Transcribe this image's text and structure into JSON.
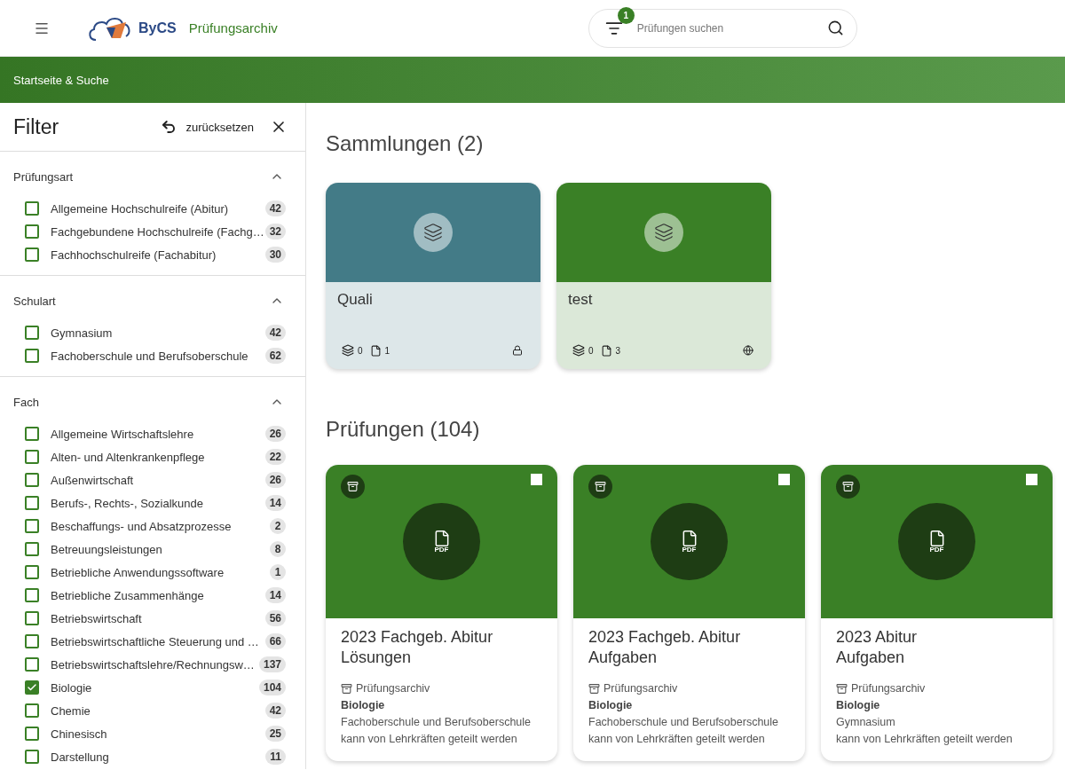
{
  "header": {
    "brand": "ByCS",
    "app_name": "Prüfungsarchiv",
    "search": {
      "placeholder": "Prüfungen suchen",
      "filter_count": "1"
    }
  },
  "breadcrumb": "Startseite & Suche",
  "filter": {
    "title": "Filter",
    "reset_label": "zurücksetzen",
    "sections": [
      {
        "title": "Prüfungsart",
        "expanded": true,
        "items": [
          {
            "label": "Allgemeine Hochschulreife (Abitur)",
            "count": "42",
            "checked": false
          },
          {
            "label": "Fachgebundene Hochschulreife (Fachg…",
            "count": "32",
            "checked": false
          },
          {
            "label": "Fachhochschulreife (Fachabitur)",
            "count": "30",
            "checked": false
          }
        ]
      },
      {
        "title": "Schulart",
        "expanded": true,
        "items": [
          {
            "label": "Gymnasium",
            "count": "42",
            "checked": false
          },
          {
            "label": "Fachoberschule und Berufsoberschule",
            "count": "62",
            "checked": false
          }
        ]
      },
      {
        "title": "Fach",
        "expanded": true,
        "items": [
          {
            "label": "Allgemeine Wirtschaftslehre",
            "count": "26",
            "checked": false
          },
          {
            "label": "Alten- und Altenkrankenpflege",
            "count": "22",
            "checked": false
          },
          {
            "label": "Außenwirtschaft",
            "count": "26",
            "checked": false
          },
          {
            "label": "Berufs-, Rechts-, Sozialkunde",
            "count": "14",
            "checked": false
          },
          {
            "label": "Beschaffungs- und Absatzprozesse",
            "count": "2",
            "checked": false
          },
          {
            "label": "Betreuungsleistungen",
            "count": "8",
            "checked": false
          },
          {
            "label": "Betriebliche Anwendungssoftware",
            "count": "1",
            "checked": false
          },
          {
            "label": "Betriebliche Zusammenhänge",
            "count": "14",
            "checked": false
          },
          {
            "label": "Betriebswirtschaft",
            "count": "56",
            "checked": false
          },
          {
            "label": "Betriebswirtschaftliche Steuerung und …",
            "count": "66",
            "checked": false
          },
          {
            "label": "Betriebswirtschaftslehre/Rechnungsw…",
            "count": "137",
            "checked": false
          },
          {
            "label": "Biologie",
            "count": "104",
            "checked": true
          },
          {
            "label": "Chemie",
            "count": "42",
            "checked": false
          },
          {
            "label": "Chinesisch",
            "count": "25",
            "checked": false
          },
          {
            "label": "Darstellung",
            "count": "11",
            "checked": false
          }
        ]
      }
    ]
  },
  "collections": {
    "heading": "Sammlungen (2)",
    "items": [
      {
        "title": "Quali",
        "color": "#437b87",
        "collections_count": "0",
        "files_count": "1",
        "public": false
      },
      {
        "title": "test",
        "color": "#3a8026",
        "collections_count": "0",
        "files_count": "3",
        "public": true
      }
    ]
  },
  "exams": {
    "heading": "Prüfungen (104)",
    "items": [
      {
        "title_lines": [
          "2023 Fachgeb. Abitur",
          "Lösungen"
        ],
        "file_type": "PDF",
        "source": "Prüfungsarchiv",
        "subject": "Biologie",
        "school_type": "Fachoberschule und Berufsoberschule",
        "sharing": "kann von Lehrkräften geteilt werden",
        "selected": false
      },
      {
        "title_lines": [
          "2023 Fachgeb. Abitur",
          "Aufgaben"
        ],
        "file_type": "PDF",
        "source": "Prüfungsarchiv",
        "subject": "Biologie",
        "school_type": "Fachoberschule und Berufsoberschule",
        "sharing": "kann von Lehrkräften geteilt werden",
        "selected": false
      },
      {
        "title_lines": [
          "2023 Abitur",
          "Aufgaben"
        ],
        "file_type": "PDF",
        "source": "Prüfungsarchiv",
        "subject": "Biologie",
        "school_type": "Gymnasium",
        "sharing": "kann von Lehrkräften geteilt werden",
        "selected": false
      }
    ]
  }
}
